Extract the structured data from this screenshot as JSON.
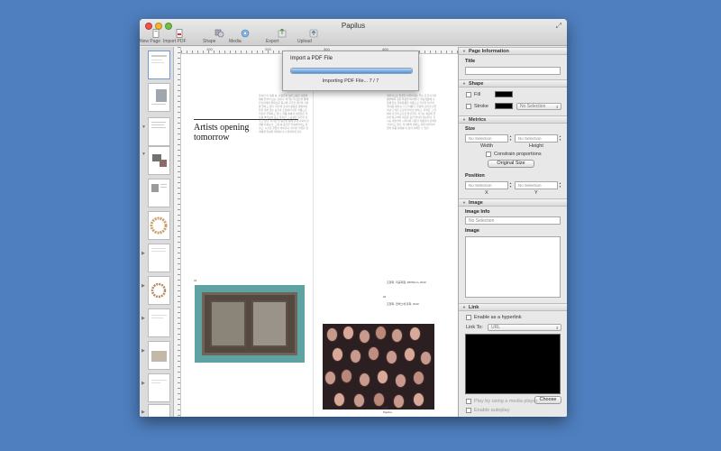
{
  "window": {
    "title": "Papilus"
  },
  "toolbar": {
    "new_page": "New Page",
    "import_pdf": "Import PDF",
    "shape": "Shape",
    "media": "Media",
    "export": "Export",
    "upload": "Upload"
  },
  "import_dialog": {
    "title": "Import a PDF File",
    "status": "Importing PDF File... 7 / 7",
    "progress": 1.0
  },
  "ruler": {
    "h_marks": [
      "100",
      "200",
      "300",
      "400"
    ]
  },
  "document": {
    "headline_line1": "Artists opening",
    "headline_line2": "tomorrow",
    "body_kr_1": "올리인 이 작품 속, 사람들이 보이고싶은 사람의 얘를 일부러 보는 것이다. 작가는 이 모습을 통해 인간관계의 위태로운 탐구와 지극한 개인의 가치를 말하고 있다. 이번이 소녀의 활동은 평범하지 않은 재치 있는 표현과 조형성이 만든 작품으로 미술을 주목하고 있다. 작품 속에서 사람들은 서로를 바라보며 웃고 있지만 그 표정은 불안을 감추고 있다. 작가는 이 풍경을 통해 현대 사회의 관계를 되묻는다. 그림 속 공간은 익숙하면서도 낯설고, 시선은 끝없이 이어진다. 이러한 작업은 관객에게 일상의 의미를 다시 생각하게 한다.",
    "body_kr_2": "계획적으로 얼굴을 만들어내는 주는 곳 유기적인 평면에서 깊은 특성을 바라본다. 일상생활에 늘 함께 있는 일회용품을 작품으로 전환한 작가의 '일회용 재미'는 더 흥미롭다. 일상의 소비가 만들어낸 흔적은 조형적 언어로 변하고, 관객은 그 안에서 자신의 모습을 발견한다. 작가는 재료의 물성을 탐구하며 새로운 표현 방식을 제시한다. 전시는 내일부터 시작되며 다양한 작품들이 관객을 기다리고 있다. 작가와의 대화도 함께 마련되어 있어 작품 세계를 더 깊이 이해할 수 있다.",
    "caption_num_1": "01",
    "caption_num_2": "02",
    "caption_1": "조형화, 미공화원, 38X52cm, 2010",
    "caption_2": "조형화, 캔버스에 유화, 2010",
    "footer_num": "163",
    "footer_text": "Papilus"
  },
  "inspector": {
    "page_info": {
      "header": "Page Information",
      "title_label": "Title",
      "title_value": ""
    },
    "shape": {
      "header": "Shape",
      "fill_label": "Fill",
      "fill_color": "#000000",
      "stroke_label": "Stroke",
      "stroke_color": "#000000",
      "stroke_value": "No Selection"
    },
    "metrics": {
      "header": "Metrics",
      "size_label": "Size",
      "width_value": "No Selection",
      "height_value": "No Selection",
      "width_label": "Width",
      "height_label": "Height",
      "constrain_label": "Constrain proportions",
      "original_size_button": "Original Size",
      "position_label": "Position",
      "x_value": "No Selection",
      "y_value": "No Selection",
      "x_label": "X",
      "y_label": "Y"
    },
    "image": {
      "header": "Image",
      "info_label": "Image Info",
      "info_value": "No Selection",
      "image_label": "Image"
    },
    "link": {
      "header": "Link",
      "hyperlink_label": "Enable as a hyperlink",
      "link_to_label": "Link To:",
      "link_to_value": "URL",
      "choose_button": "Choose",
      "media_player_label": "Play by using a media player",
      "autoplay_label": "Enable autoplay"
    }
  },
  "colors": {
    "desktop": "#4f7fbf",
    "progress_fill": "#4f90d8",
    "photo_frame": "#5ea3a2"
  }
}
